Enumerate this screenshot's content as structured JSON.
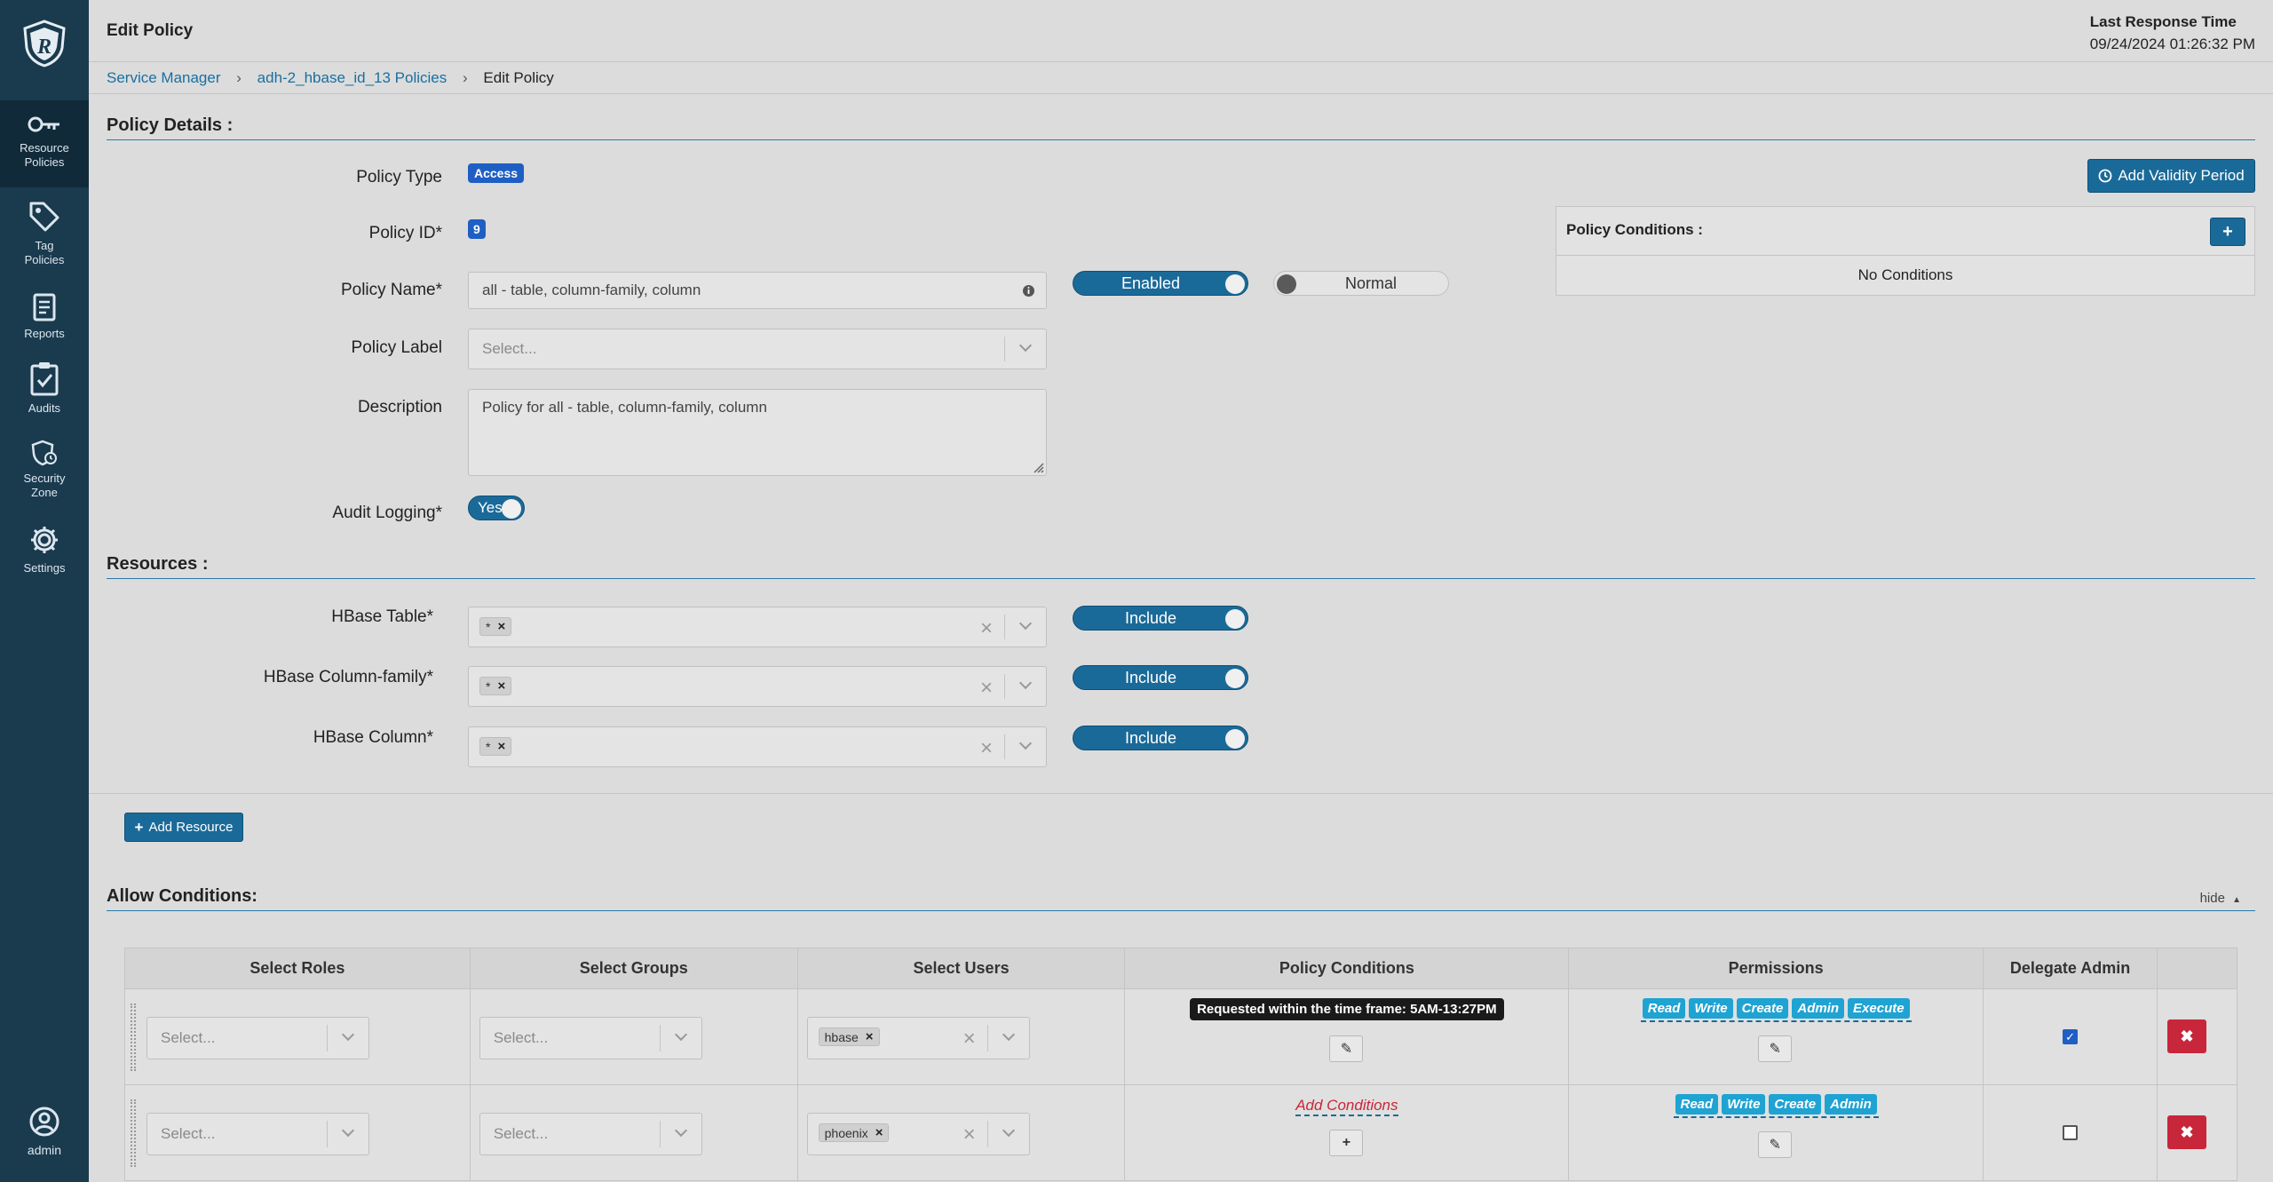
{
  "sidebar": {
    "items": [
      {
        "label_1": "Resource",
        "label_2": "Policies",
        "icon": "key-icon"
      },
      {
        "label_1": "Tag",
        "label_2": "Policies",
        "icon": "tag-icon"
      },
      {
        "label_1": "Reports",
        "label_2": "",
        "icon": "report-icon"
      },
      {
        "label_1": "Audits",
        "label_2": "",
        "icon": "clipboard-check-icon"
      },
      {
        "label_1": "Security",
        "label_2": "Zone",
        "icon": "security-zone-icon"
      },
      {
        "label_1": "Settings",
        "label_2": "",
        "icon": "gear-icon"
      }
    ],
    "user": "admin"
  },
  "header": {
    "title": "Edit Policy",
    "last_response_label": "Last Response Time",
    "last_response_value": "09/24/2024 01:26:32 PM"
  },
  "breadcrumb": [
    "Service Manager",
    "adh-2_hbase_id_13 Policies",
    "Edit Policy"
  ],
  "policy_details": {
    "section_title": "Policy Details :",
    "policy_type_label": "Policy Type",
    "policy_type_value": "Access",
    "policy_id_label": "Policy ID*",
    "policy_id_value": "9",
    "policy_name_label": "Policy Name*",
    "policy_name_value": "all - table, column-family, column",
    "enabled_toggle": "Enabled",
    "normal_toggle": "Normal",
    "policy_label_label": "Policy Label",
    "policy_label_placeholder": "Select...",
    "description_label": "Description",
    "description_value": "Policy for all - table, column-family, column",
    "audit_logging_label": "Audit Logging*",
    "audit_logging_value": "Yes",
    "add_validity_button": "Add Validity Period",
    "conditions_title": "Policy Conditions :",
    "conditions_empty": "No Conditions"
  },
  "resources": {
    "section_title": "Resources :",
    "items": [
      {
        "label": "HBase Table*",
        "value": "*",
        "toggle": "Include"
      },
      {
        "label": "HBase Column-family*",
        "value": "*",
        "toggle": "Include"
      },
      {
        "label": "HBase Column*",
        "value": "*",
        "toggle": "Include"
      }
    ],
    "add_resource_button": "Add Resource"
  },
  "allow_conditions": {
    "section_title": "Allow Conditions:",
    "hide_label": "hide",
    "columns": [
      "Select Roles",
      "Select Groups",
      "Select Users",
      "Policy Conditions",
      "Permissions",
      "Delegate Admin"
    ],
    "rows": [
      {
        "roles_placeholder": "Select...",
        "groups_placeholder": "Select...",
        "user": "hbase",
        "condition": "Requested within the time frame: 5AM-13:27PM",
        "permissions": [
          "Read",
          "Write",
          "Create",
          "Admin",
          "Execute"
        ],
        "delegate_admin": true
      },
      {
        "roles_placeholder": "Select...",
        "groups_placeholder": "Select...",
        "user": "phoenix",
        "condition": "Add Conditions",
        "permissions": [
          "Read",
          "Write",
          "Create",
          "Admin"
        ],
        "delegate_admin": false
      }
    ]
  },
  "colors": {
    "sidebar": "#1a3a4e",
    "accent": "#1a6a99",
    "badge": "#1f5fc4",
    "permission_tag": "#1fa3d3",
    "danger": "#c8263a"
  }
}
